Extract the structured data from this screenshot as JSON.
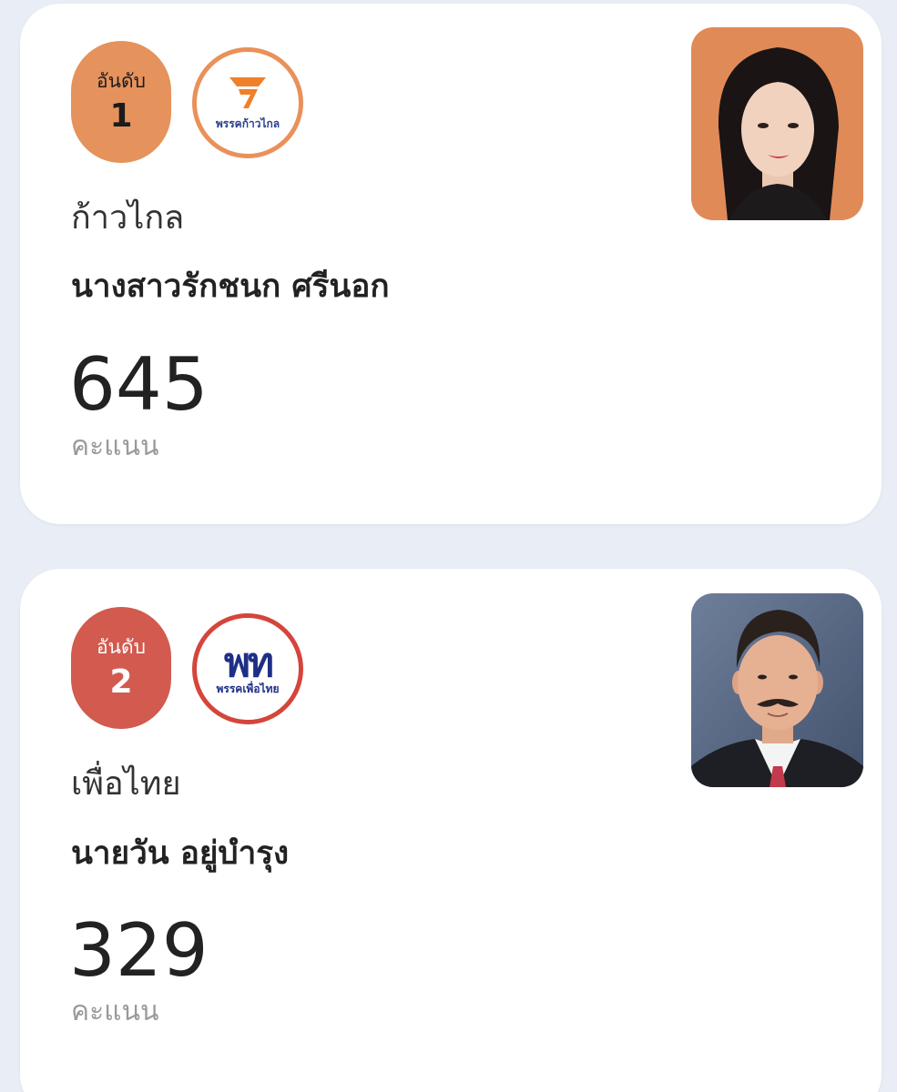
{
  "rank_label": "อันดับ",
  "vote_unit": "คะแนน",
  "candidates": [
    {
      "rank": "1",
      "rank_color": "#e5925c",
      "party_logo_caption": "พรรคก้าวไกล",
      "party_logo_icon": "move-forward-party-logo-icon",
      "party": "ก้าวไกล",
      "name": "นางสาวรักชนก ศรีนอก",
      "votes": "645",
      "photo_background": "#e08a58"
    },
    {
      "rank": "2",
      "rank_color": "#d25a4f",
      "party_logo_mark": "พท",
      "party_logo_caption": "พรรคเพื่อไทย",
      "party_logo_icon": "pheu-thai-party-logo-icon",
      "party": "เพื่อไทย",
      "name": "นายวัน อยู่บำรุง",
      "votes": "329",
      "photo_background": "#5a6b88"
    }
  ]
}
